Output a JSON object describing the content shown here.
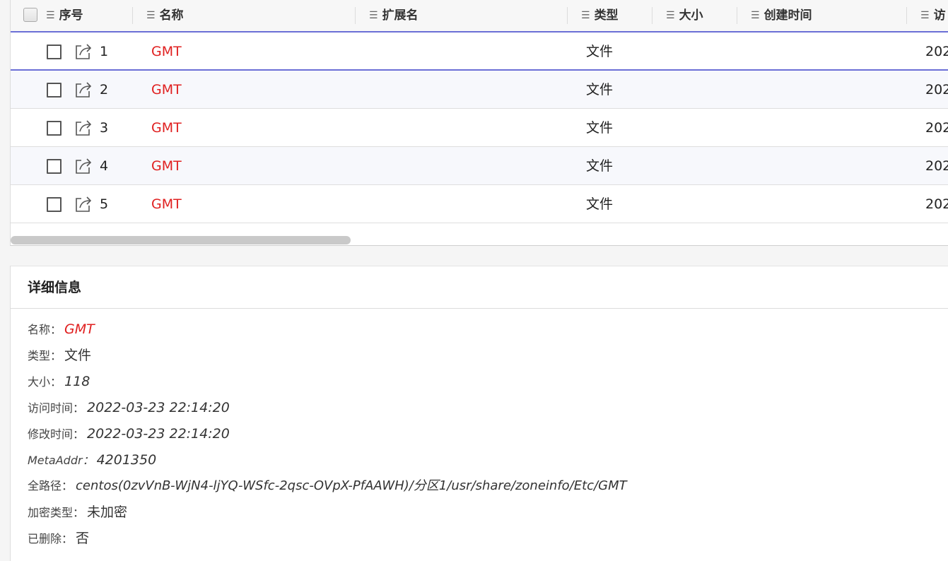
{
  "table": {
    "columns": [
      {
        "label": "序号"
      },
      {
        "label": "名称"
      },
      {
        "label": "扩展名"
      },
      {
        "label": "类型"
      },
      {
        "label": "大小"
      },
      {
        "label": "创建时间"
      },
      {
        "label": "访"
      }
    ],
    "rows": [
      {
        "index": "1",
        "name": "GMT",
        "type": "文件",
        "date": "202"
      },
      {
        "index": "2",
        "name": "GMT",
        "type": "文件",
        "date": "202"
      },
      {
        "index": "3",
        "name": "GMT",
        "type": "文件",
        "date": "202"
      },
      {
        "index": "4",
        "name": "GMT",
        "type": "文件",
        "date": "202"
      },
      {
        "index": "5",
        "name": "GMT",
        "type": "文件",
        "date": "202"
      }
    ],
    "selected_row": 1,
    "list_icon": "list-icon",
    "open_icon": "external-open-icon"
  },
  "details": {
    "title": "详细信息",
    "fields": [
      {
        "label": "名称：",
        "value": "GMT"
      },
      {
        "label": "类型：",
        "value": "文件"
      },
      {
        "label": "大小：",
        "value": "118"
      },
      {
        "label": "访问时间：",
        "value": "2022-03-23 22:14:20"
      },
      {
        "label": "修改时间：",
        "value": "2022-03-23 22:14:20"
      },
      {
        "label": "MetaAddr：",
        "value": "4201350"
      },
      {
        "label": "全路径：",
        "value": "centos(0zvVnB-WjN4-ljYQ-WSfc-2qsc-OVpX-PfAAWH)/分区1/usr/share/zoneinfo/Etc/GMT"
      },
      {
        "label": "加密类型：",
        "value": "未加密"
      },
      {
        "label": "已删除：",
        "value": "否"
      }
    ]
  },
  "colors": {
    "accent": "#6b6fd6",
    "name_text": "#e02020",
    "row_alt": "#f7f8fc"
  }
}
